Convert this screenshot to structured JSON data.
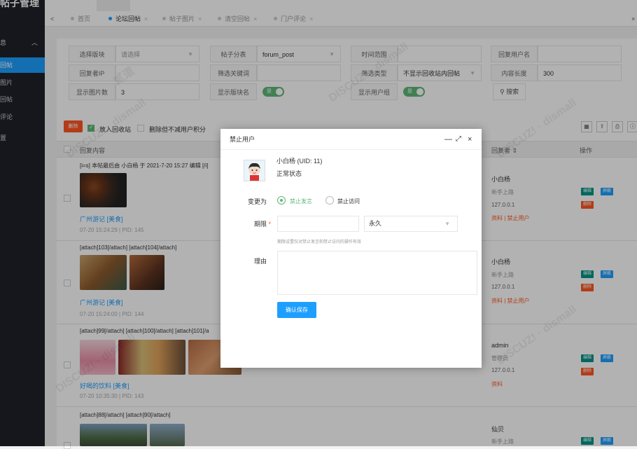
{
  "sidebar": {
    "title": "帖子管理",
    "group": "息",
    "items": [
      {
        "label": "回帖",
        "active": true
      },
      {
        "label": "图片",
        "active": false
      },
      {
        "label": "回帖",
        "active": false
      },
      {
        "label": "评论",
        "active": false
      },
      {
        "label": "置",
        "active": false
      }
    ]
  },
  "topbar": {
    "active_tab": "帖子管理"
  },
  "tabs": [
    {
      "label": "首页",
      "active": false,
      "closable": false
    },
    {
      "label": "论坛回帖",
      "active": true,
      "closable": true
    },
    {
      "label": "帖子图片",
      "active": false,
      "closable": true
    },
    {
      "label": "清空回帖",
      "active": false,
      "closable": true
    },
    {
      "label": "门户评论",
      "active": false,
      "closable": true
    }
  ],
  "filters": {
    "board_label": "选择版块",
    "board_placeholder": "请选择",
    "category_label": "帖子分表",
    "category_value": "forum_post",
    "time_label": "时间范围",
    "reply_user_label": "回复用户名",
    "ip_label": "回复者IP",
    "keyword_label": "筛选关键词",
    "type_label": "筛选类型",
    "type_value": "不显示回收站内回帖",
    "length_label": "内容长度",
    "length_value": "300",
    "imgcount_label": "显示图片数",
    "imgcount_value": "3",
    "showboard_label": "显示版块名",
    "showboard_switch": "是",
    "usergroup_label": "显示用户组",
    "usergroup_switch": "是",
    "search_button": "搜索"
  },
  "toolbar": {
    "delete_button": "删除",
    "recycle_label": "放入回收站",
    "nodeduct_label": "删除但不减用户积分"
  },
  "table": {
    "col_content": "回复内容",
    "col_author": "回复者",
    "col_actions": "操作",
    "rows": [
      {
        "text": "[i=s] 本帖最后由 小白杨 于 2021-7-20 15:27 编辑 [/i]",
        "thread": "广州游记 [美食]",
        "meta": "07-20 15:24:29 | PID: 145",
        "author": "小白杨",
        "group": "新手上路",
        "ip": "127.0.0.1",
        "links": "资料 | 禁止用户"
      },
      {
        "text": "[attach]103[/attach] [attach]104[/attach]",
        "thread": "广州游记 [美食]",
        "meta": "07-20 15:24:00 | PID: 144",
        "author": "小白杨",
        "group": "新手上路",
        "ip": "127.0.0.1",
        "links": "资料 | 禁止用户"
      },
      {
        "text": "[attach]99[/attach] [attach]100[/attach] [attach]101[/a",
        "thread": "好喝的饮料 [美食]",
        "meta": "07-20 10:35:30 | PID: 143",
        "author": "admin",
        "group": "管理员",
        "ip": "127.0.0.1",
        "links": "资料"
      },
      {
        "text": "[attach]88[/attach] [attach]90[/attach]",
        "thread": "",
        "meta": "",
        "author": "仙贝",
        "group": "新手上路",
        "ip": "",
        "links": ""
      }
    ],
    "op_edit": "编辑",
    "op_block": "屏蔽",
    "op_delete": "删除"
  },
  "watermark": {
    "text": "DISCUZ!应用中心 | 贰道",
    "sub": "addon.dismall.com"
  },
  "modal": {
    "title": "禁止用户",
    "user_line": "小白杨 (UID: 11)",
    "status": "正常状态",
    "change_label": "变更为",
    "option_ban_post": "禁止发言",
    "option_ban_visit": "禁止访问",
    "period_label": "期限",
    "period_value": "永久",
    "period_hint": "期限设置仅对禁止发言和禁止访问的操作有效",
    "reason_label": "理由",
    "save_button": "确认保存"
  },
  "colors": {
    "primary": "#1e9fff",
    "green": "#5fb878",
    "danger": "#ff5722",
    "sidebar": "#20222a"
  }
}
